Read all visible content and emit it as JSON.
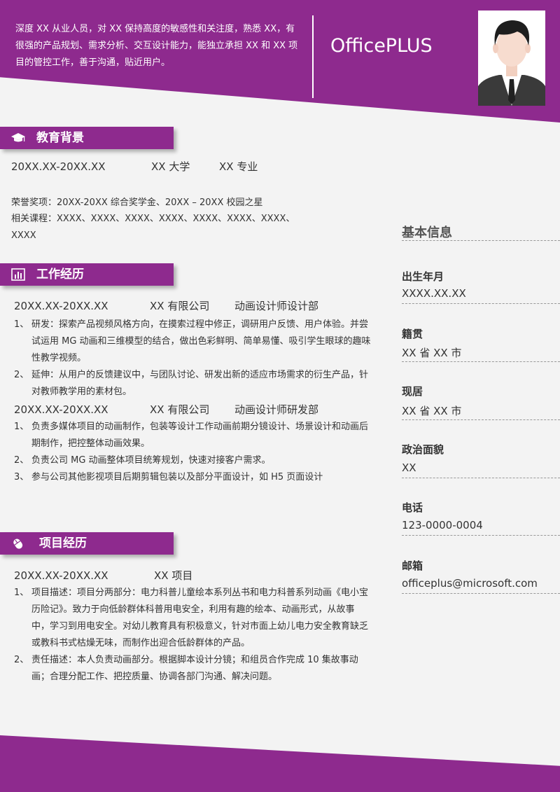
{
  "header": {
    "intro": "深度 XX 从业人员，对 XX 保持高度的敏感性和关注度，熟悉 XX，有很强的产品规划、需求分析、交互设计能力，能独立承担 XX 和 XX 项目的管控工作，善于沟通，贴近用户。",
    "brand": "OfficePLUS"
  },
  "education": {
    "title": "教育背景",
    "icon": "graduation-cap-icon",
    "period": "20XX.XX-20XX.XX",
    "school": "XX 大学",
    "major": "XX 专业",
    "honors": "荣誉奖项：20XX-20XX 综合奖学金、20XX – 20XX 校园之星",
    "courses": "相关课程：XXXX、XXXX、XXXX、XXXX、XXXX、XXXX、XXXX、XXXX"
  },
  "work": {
    "title": "工作经历",
    "icon": "bar-chart-icon",
    "jobs": [
      {
        "period": "20XX.XX-20XX.XX",
        "company": "XX 有限公司",
        "position": "动画设计师设计部",
        "items": [
          {
            "num": "1、",
            "text": "研发：探索产品视频风格方向，在摸索过程中修正，调研用户反馈、用户体验。并尝试运用 MG 动画和三维模型的结合，做出色彩鲜明、简单易懂、吸引学生眼球的趣味性教学视频。"
          },
          {
            "num": "2、",
            "text": "延伸：从用户的反馈建议中，与团队讨论、研发出新的适应市场需求的衍生产品，针对教师教学用的素材包。"
          }
        ]
      },
      {
        "period": "20XX.XX-20XX.XX",
        "company": "XX 有限公司",
        "position": "动画设计师研发部",
        "items": [
          {
            "num": "1、",
            "text": "负责多媒体项目的动画制作，包装等设计工作动画前期分镜设计、场景设计和动画后期制作，把控整体动画效果。"
          },
          {
            "num": "2、",
            "text": "负责公司 MG 动画整体项目统筹规划，快速对接客户需求。"
          },
          {
            "num": "3、",
            "text": "参与公司其他影视项目后期剪辑包装以及部分平面设计，如 H5 页面设计"
          }
        ]
      }
    ]
  },
  "projects": {
    "title": "项目经历",
    "icon": "mouse-icon",
    "period": "20XX.XX-20XX.XX",
    "name": "XX 项目",
    "items": [
      {
        "num": "1、",
        "text": "项目描述：项目分两部分：电力科普儿童绘本系列丛书和电力科普系列动画《电小宝历险记》。致力于向低龄群体科普用电安全，利用有趣的绘本、动画形式，从故事中，学习到用电安全。对幼儿教育具有积极意义，针对市面上幼儿电力安全教育缺乏或教科书式枯燥无味，而制作出迎合低龄群体的产品。"
      },
      {
        "num": "2、",
        "text": "责任描述：本人负责动画部分。根据脚本设计分镜；和组员合作完成 10 集故事动画；合理分配工作、把控质量、协调各部门沟通、解决问题。"
      }
    ]
  },
  "basic_info": {
    "title": "基本信息",
    "fields": [
      {
        "label": "出生年月",
        "value": "XXXX.XX.XX"
      },
      {
        "label": "籍贯",
        "value": "XX 省 XX 市"
      },
      {
        "label": "现居",
        "value": "XX 省 XX 市"
      },
      {
        "label": "政治面貌",
        "value": "XX"
      },
      {
        "label": "电话",
        "value": "123-0000-0004"
      },
      {
        "label": "邮箱",
        "value": "officeplus@microsoft.com"
      }
    ]
  },
  "colors": {
    "accent": "#8e2a8e",
    "background": "#f3f3f3",
    "text": "#333333"
  }
}
